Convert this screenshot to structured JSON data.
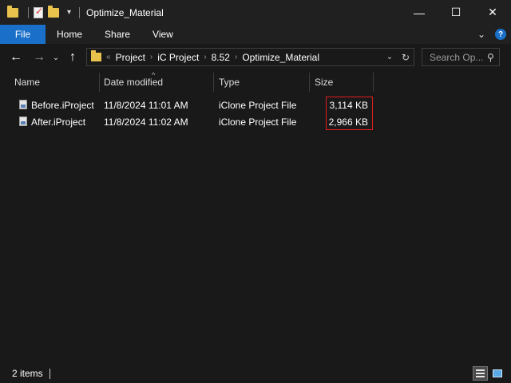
{
  "window": {
    "title": "Optimize_Material",
    "minimize_glyph": "—",
    "maximize_glyph": "☐",
    "close_glyph": "✕"
  },
  "ribbon": {
    "tabs": [
      "File",
      "Home",
      "Share",
      "View"
    ],
    "expand_glyph": "⌄",
    "help_glyph": "?"
  },
  "nav": {
    "back_glyph": "←",
    "forward_glyph": "→",
    "recent_glyph": "⌄",
    "up_glyph": "↑",
    "overflow_glyph": "«",
    "breadcrumb": [
      "Project",
      "iC Project",
      "8.52",
      "Optimize_Material"
    ],
    "crumb_sep": "›",
    "address_dropdown_glyph": "⌄",
    "refresh_glyph": "↻",
    "search_placeholder": "Search Op...",
    "search_icon_glyph": "⚲"
  },
  "columns": {
    "name": "Name",
    "date_modified": "Date modified",
    "type": "Type",
    "size": "Size",
    "sort_glyph": "^"
  },
  "files": [
    {
      "name": "Before.iProject",
      "date": "11/8/2024 11:01 AM",
      "type": "iClone Project File",
      "size": "3,114 KB"
    },
    {
      "name": "After.iProject",
      "date": "11/8/2024 11:02 AM",
      "type": "iClone Project File",
      "size": "2,966 KB"
    }
  ],
  "status": {
    "item_count": "2 items"
  },
  "colors": {
    "accent": "#1a6fc9",
    "highlight_box": "#e11d1d",
    "background": "#191919"
  }
}
